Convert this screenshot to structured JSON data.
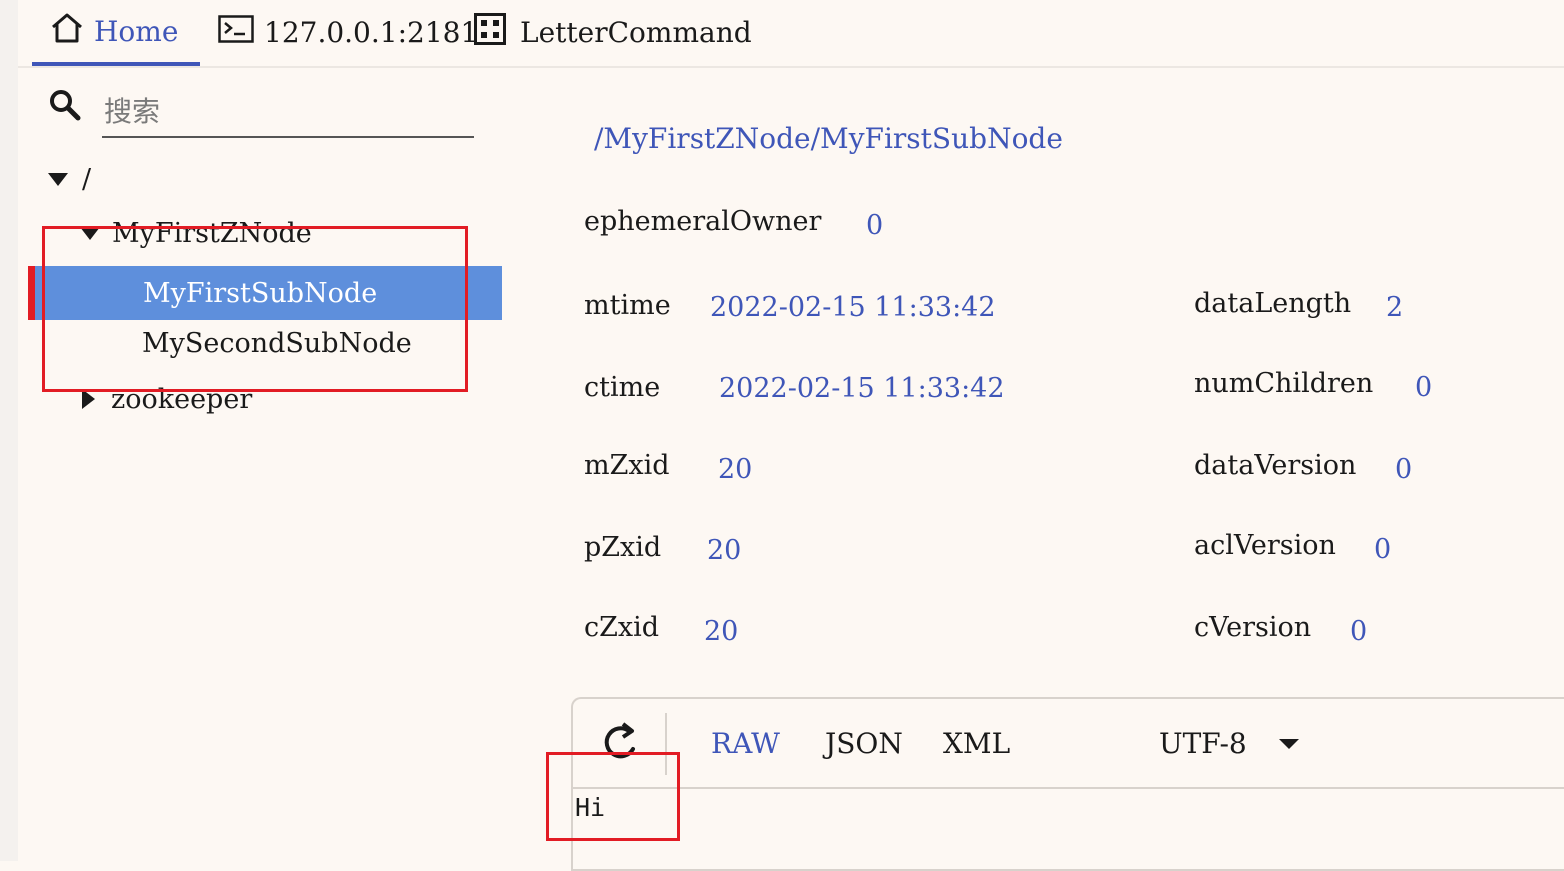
{
  "tabs": {
    "home": "Home",
    "connection": "127.0.0.1:2181",
    "command": "LetterCommand"
  },
  "search": {
    "placeholder": "搜索"
  },
  "tree": {
    "root": "/",
    "node1": "MyFirstZNode",
    "node1_children": [
      "MyFirstSubNode",
      "MySecondSubNode"
    ],
    "node2": "zookeeper"
  },
  "detail": {
    "path": "/MyFirstZNode/MyFirstSubNode",
    "ephemeralOwner": {
      "label": "ephemeralOwner",
      "value": "0"
    },
    "mtime": {
      "label": "mtime",
      "value": "2022-02-15 11:33:42"
    },
    "ctime": {
      "label": "ctime",
      "value": "2022-02-15 11:33:42"
    },
    "mZxid": {
      "label": "mZxid",
      "value": "20"
    },
    "pZxid": {
      "label": "pZxid",
      "value": "20"
    },
    "cZxid": {
      "label": "cZxid",
      "value": "20"
    },
    "dataLength": {
      "label": "dataLength",
      "value": "2"
    },
    "numChildren": {
      "label": "numChildren",
      "value": "0"
    },
    "dataVersion": {
      "label": "dataVersion",
      "value": "0"
    },
    "aclVersion": {
      "label": "aclVersion",
      "value": "0"
    },
    "cVersion": {
      "label": "cVersion",
      "value": "0"
    }
  },
  "viewer": {
    "formats": [
      "RAW",
      "JSON",
      "XML"
    ],
    "encoding": "UTF-8",
    "content": "Hi"
  },
  "colors": {
    "accent": "#3f56b8",
    "selection": "#5e8fdc",
    "highlight": "#e21c24",
    "background": "#fdf8f3"
  }
}
